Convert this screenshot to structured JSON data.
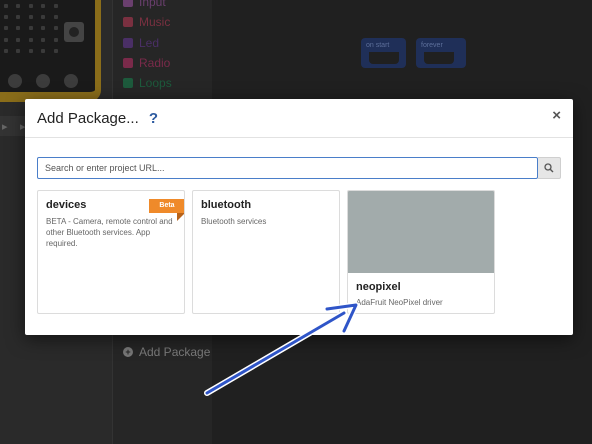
{
  "toolbox": {
    "items": [
      {
        "label": "Input",
        "color": "#6a3f6e"
      },
      {
        "label": "Music",
        "color": "#7a3040"
      },
      {
        "label": "Led",
        "color": "#4a2f66"
      },
      {
        "label": "Radio",
        "color": "#7a2a4a"
      },
      {
        "label": "Loops",
        "color": "#1d5a3c"
      }
    ],
    "add_package_label": "Add Package"
  },
  "workspace": {
    "blocks": [
      {
        "label": "on start"
      },
      {
        "label": "forever"
      }
    ]
  },
  "modal": {
    "title": "Add Package...",
    "help_icon": "?",
    "close_icon": "×",
    "search": {
      "placeholder": "Search or enter project URL...",
      "value": "",
      "button_icon": "search-icon"
    },
    "packages": [
      {
        "name": "devices",
        "description": "BETA - Camera, remote control and other Bluetooth services. App required.",
        "badge": "Beta",
        "badge_color": "#ef8a2a"
      },
      {
        "name": "bluetooth",
        "description": "Bluetooth services"
      },
      {
        "name": "neopixel",
        "description": "AdaFruit NeoPixel driver",
        "image_color": "#a2abab"
      }
    ]
  },
  "annotation": {
    "arrow_color": "#2f55c8"
  }
}
